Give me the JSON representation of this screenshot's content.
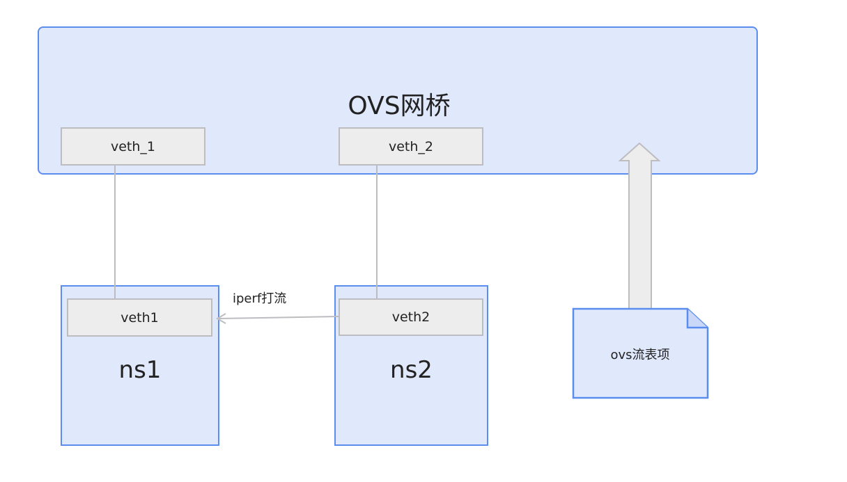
{
  "bridge": {
    "title": "OVS网桥",
    "ports": [
      "veth_1",
      "veth_2"
    ]
  },
  "namespaces": [
    {
      "name": "ns1",
      "port": "veth1"
    },
    {
      "name": "ns2",
      "port": "veth2"
    }
  ],
  "traffic": {
    "label": "iperf打流"
  },
  "flow_table": {
    "label": "ovs流表项"
  },
  "colors": {
    "box_fill": "#e0e8fc",
    "box_border": "#5b8def",
    "port_fill": "#ededee",
    "port_border": "#bdbdc1",
    "connector": "#bdbdc1"
  }
}
